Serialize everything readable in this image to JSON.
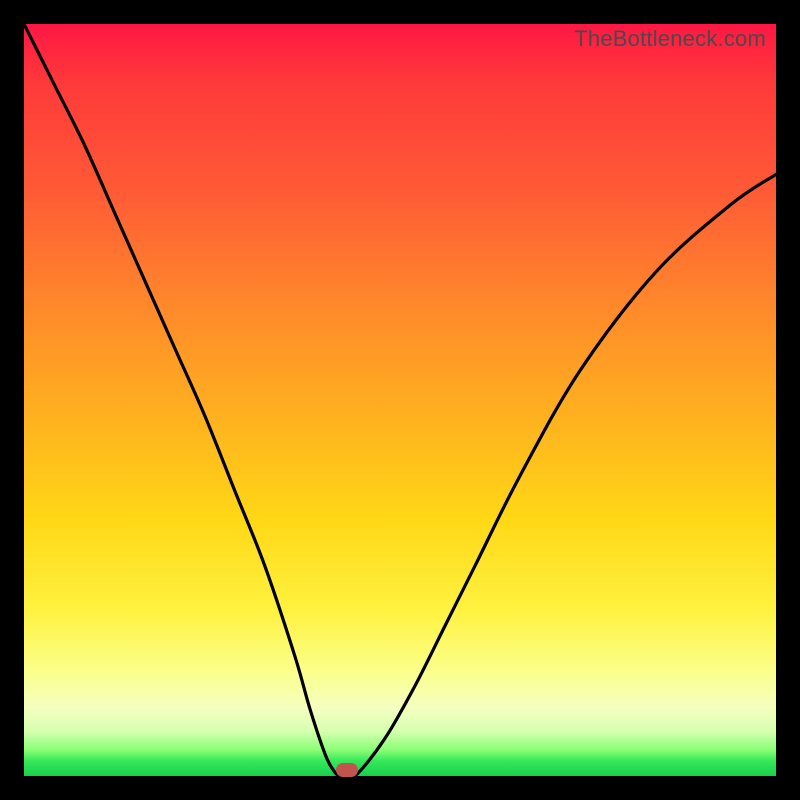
{
  "watermark": "TheBottleneck.com",
  "chart_data": {
    "type": "line",
    "title": "",
    "xlabel": "",
    "ylabel": "",
    "xlim": [
      0,
      100
    ],
    "ylim": [
      0,
      100
    ],
    "grid": false,
    "series": [
      {
        "name": "curve",
        "x": [
          0,
          4,
          8,
          12,
          16,
          20,
          24,
          28,
          32,
          36,
          38,
          40,
          41,
          42,
          44,
          48,
          52,
          56,
          60,
          66,
          74,
          84,
          94,
          100
        ],
        "y": [
          100,
          92,
          84,
          75,
          66,
          57,
          48,
          38,
          28,
          16,
          9,
          3,
          1,
          0,
          0,
          5,
          12,
          20,
          28,
          40,
          54,
          67,
          76,
          80
        ]
      }
    ],
    "marker": {
      "x": 43,
      "y": 0.8,
      "color": "#c1554d"
    },
    "background_gradient": {
      "top": "#ff1744",
      "mid": "#ffd816",
      "bottom": "#17d14a"
    }
  }
}
